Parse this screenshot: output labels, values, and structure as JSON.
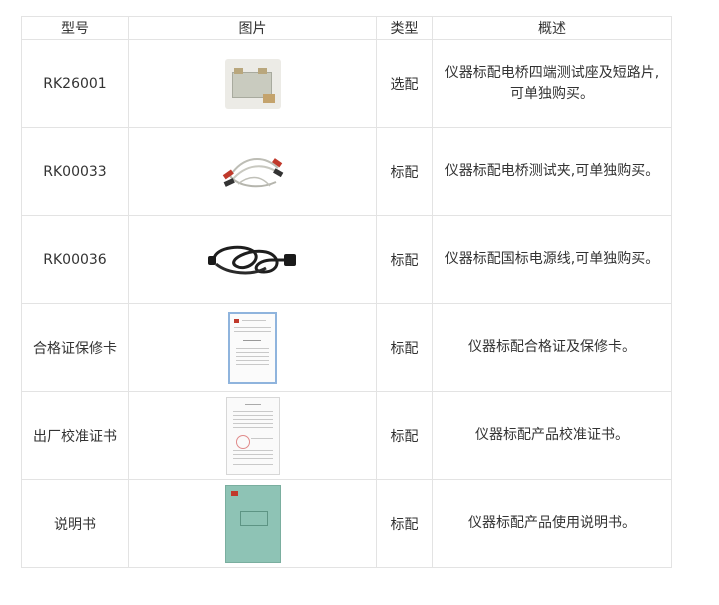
{
  "table": {
    "headers": [
      "型号",
      "图片",
      "类型",
      "概述"
    ],
    "rows": [
      {
        "model": "RK26001",
        "image": "test-fixture-and-shorting-piece",
        "type": "选配",
        "desc_line1": "仪器标配电桥四端测试座及短路片,",
        "desc_line2": "可单独购买。"
      },
      {
        "model": "RK00033",
        "image": "test-clip-cable",
        "type": "标配",
        "desc_line1": "仪器标配电桥测试夹,可单独购买。",
        "desc_line2": ""
      },
      {
        "model": "RK00036",
        "image": "power-cord",
        "type": "标配",
        "desc_line1": "仪器标配国标电源线,可单独购买。",
        "desc_line2": ""
      },
      {
        "model": "合格证保修卡",
        "image": "warranty-card",
        "type": "标配",
        "desc_line1": "仪器标配合格证及保修卡。",
        "desc_line2": ""
      },
      {
        "model": "出厂校准证书",
        "image": "calibration-certificate",
        "type": "标配",
        "desc_line1": "仪器标配产品校准证书。",
        "desc_line2": ""
      },
      {
        "model": "说明书",
        "image": "user-manual",
        "type": "标配",
        "desc_line1": "仪器标配产品使用说明书。",
        "desc_line2": ""
      }
    ]
  }
}
